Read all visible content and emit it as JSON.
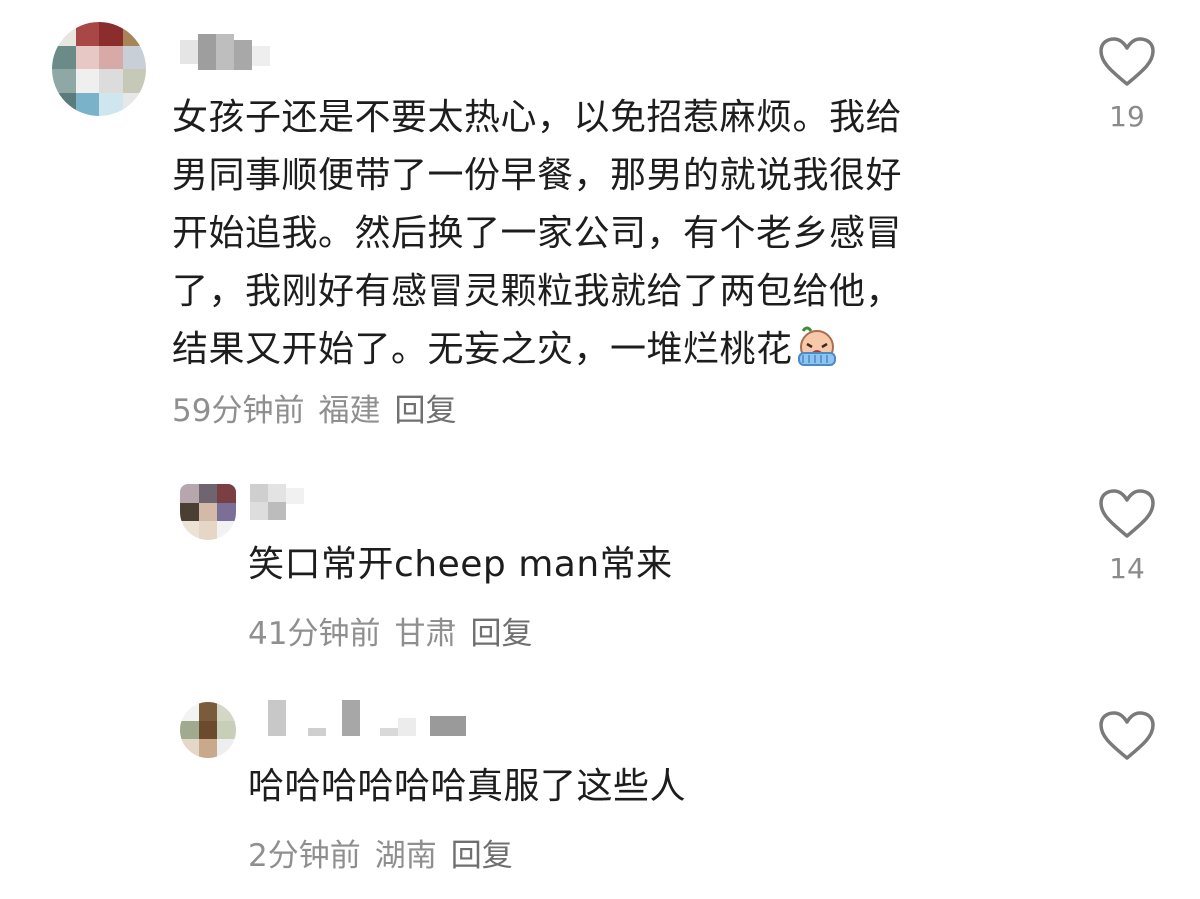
{
  "comments": [
    {
      "text": "女孩子还是不要太热心，以免招惹麻烦。我给\n男同事顺便带了一份早餐，那男的就说我很好\n开始追我。然后换了一家公司，有个老乡感冒\n了，我刚好有感冒灵颗粒我就给了两包给他，\n结果又开始了。无妄之灾，一堆烂桃花",
      "time": "59分钟前",
      "location": "福建",
      "reply_label": "回复",
      "likes": "19",
      "emoji": "crying-face-emoji"
    },
    {
      "text": "笑口常开cheep man常来",
      "time": "41分钟前",
      "location": "甘肃",
      "reply_label": "回复",
      "likes": "14"
    },
    {
      "text": "哈哈哈哈哈哈真服了这些人",
      "time": "2分钟前",
      "location": "湖南",
      "reply_label": "回复",
      "likes": ""
    }
  ],
  "icons": {
    "like": "heart-outline-icon"
  },
  "colors": {
    "text": "#1d1d1d",
    "meta": "#8f8f8f",
    "icon": "#7a7a7a"
  }
}
